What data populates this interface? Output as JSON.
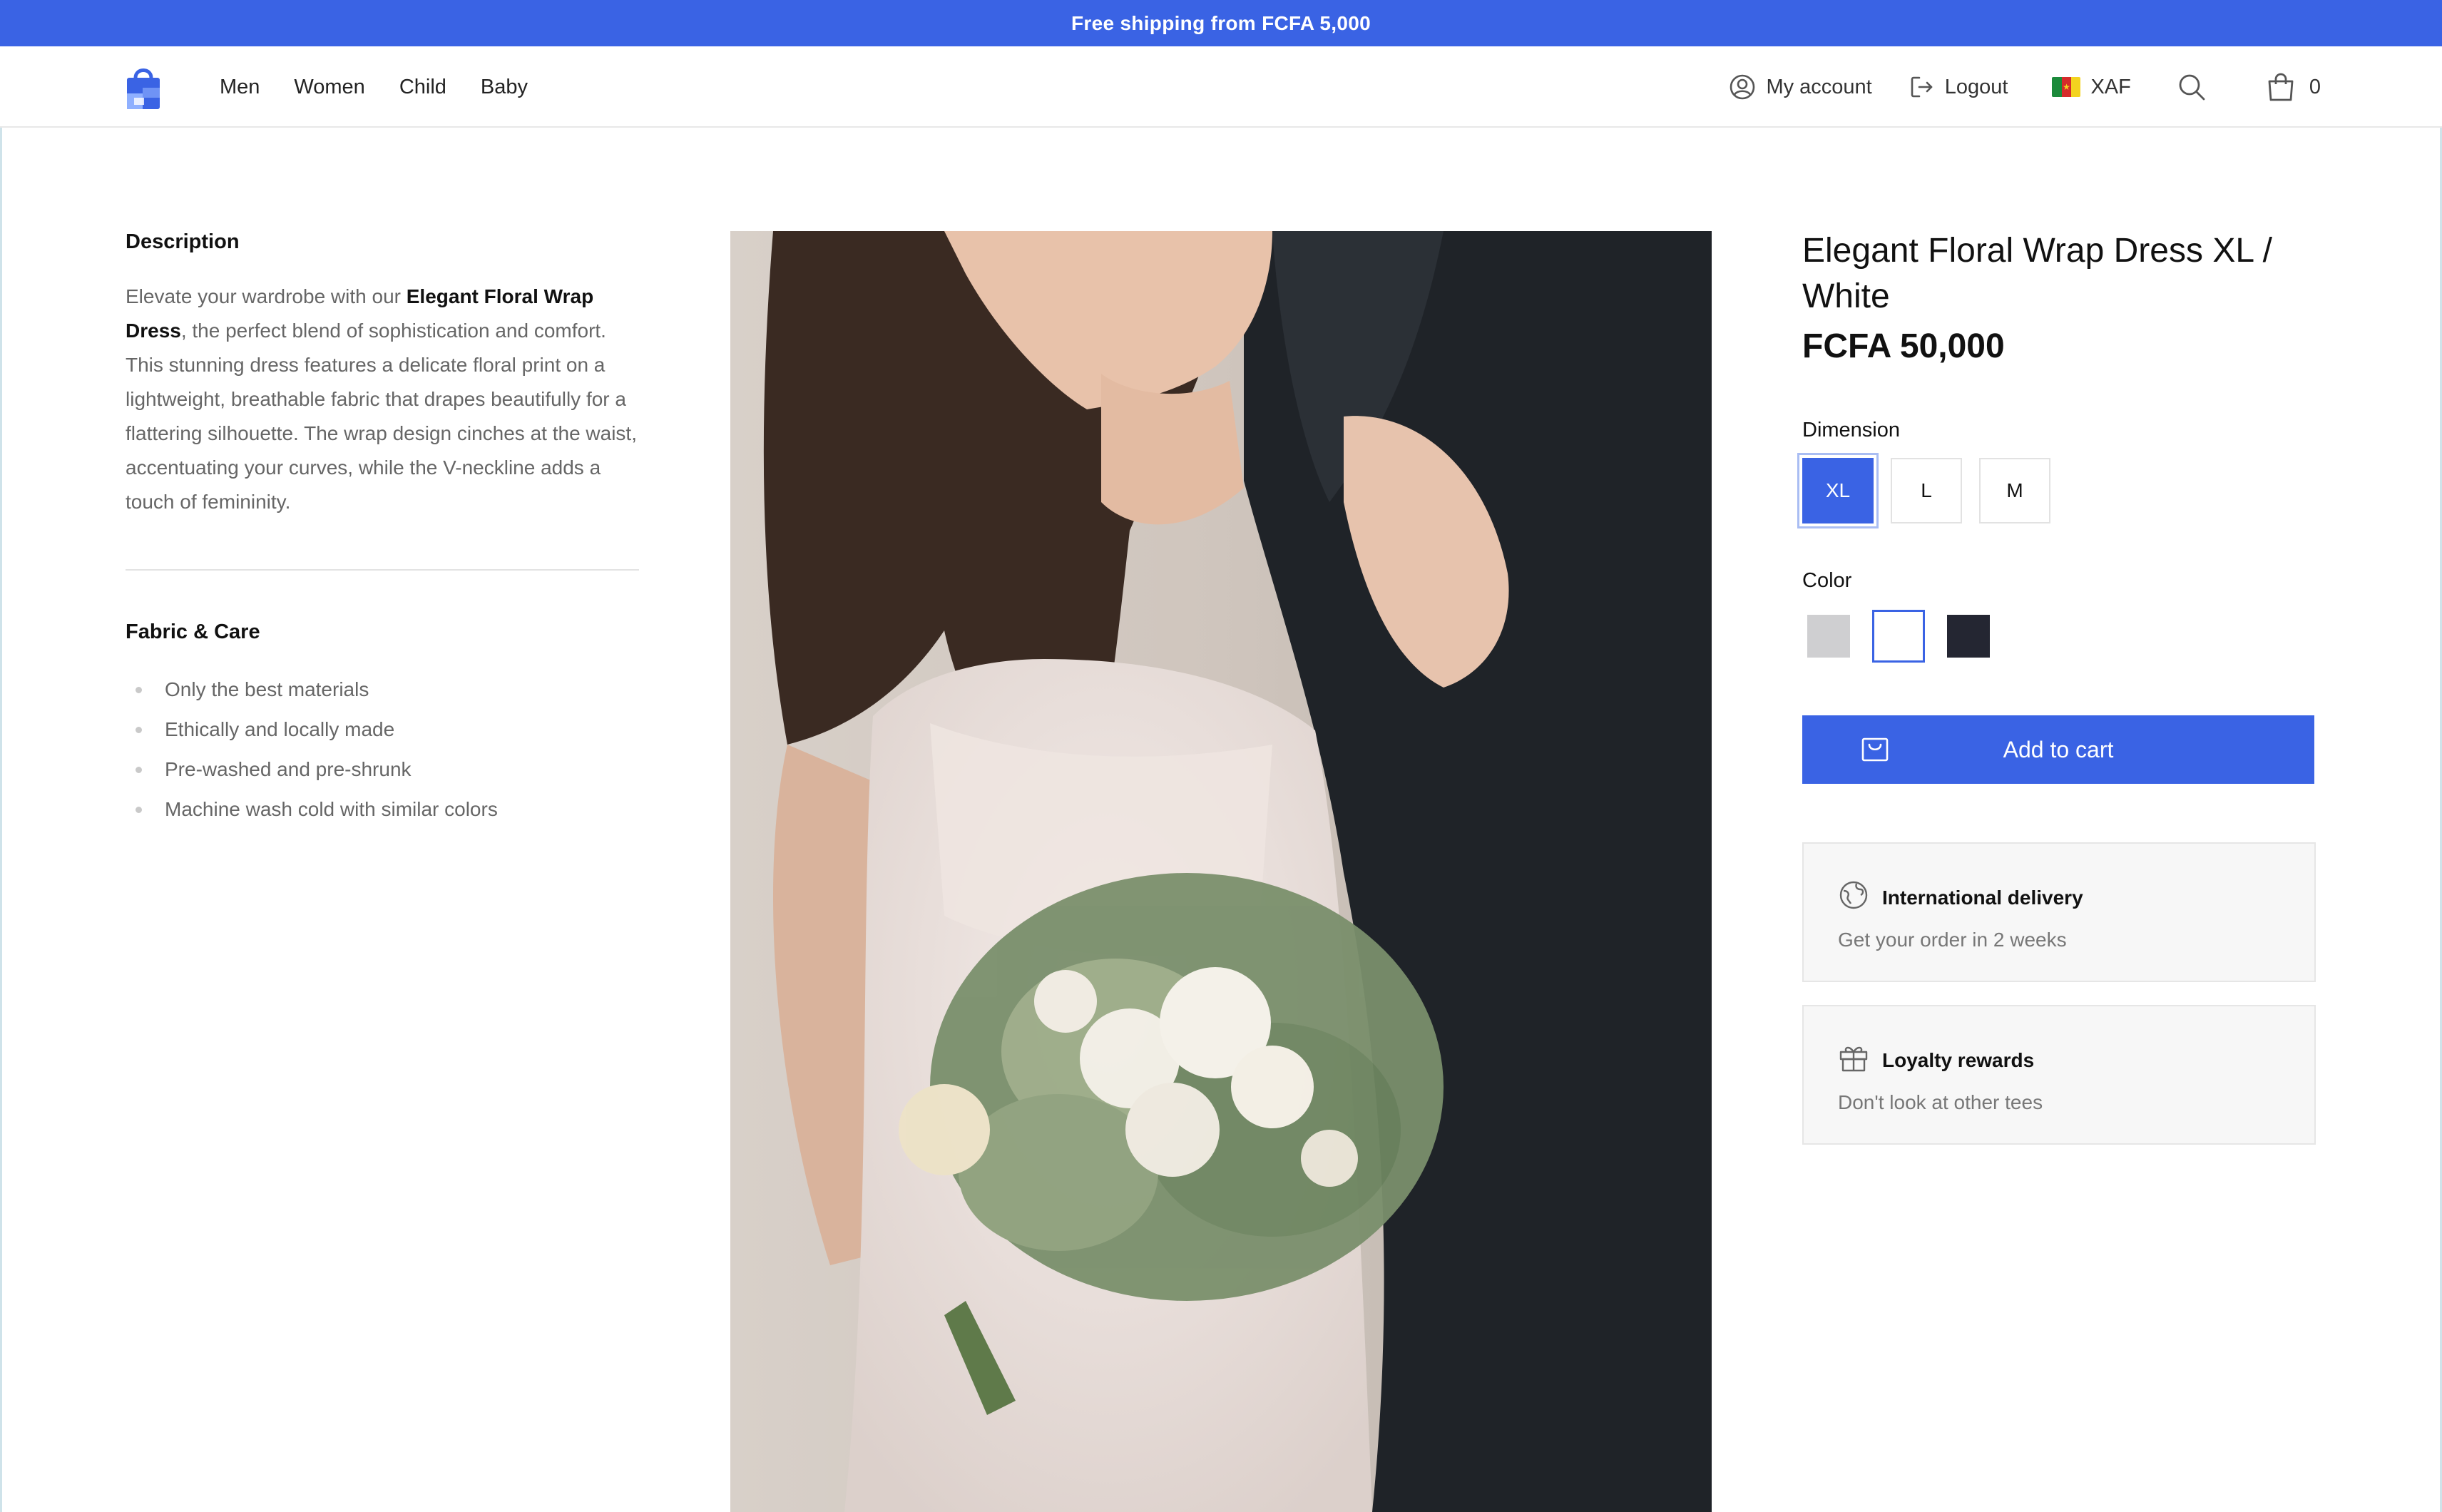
{
  "promo": {
    "text": "Free shipping from FCFA 5,000"
  },
  "header": {
    "nav": [
      "Men",
      "Women",
      "Child",
      "Baby"
    ],
    "account_label": "My account",
    "logout_label": "Logout",
    "currency": "XAF",
    "cart_count": "0",
    "flag_icon": "cameroon-flag-icon",
    "brand_color": "#3a63e4"
  },
  "description": {
    "title": "Description",
    "text_before": "Elevate your wardrobe with our ",
    "text_bold": "Elegant Floral Wrap Dress",
    "text_after": ", the perfect blend of sophistication and comfort. This stunning dress features a delicate floral print on a lightweight, breathable fabric that drapes beautifully for a flattering silhouette. The wrap design cinches at the waist, accentuating your curves, while the V-neckline adds a touch of femininity."
  },
  "fabric": {
    "title": "Fabric & Care",
    "items": [
      "Only the best materials",
      "Ethically and locally made",
      "Pre-washed and pre-shrunk",
      "Machine wash cold with similar colors"
    ]
  },
  "product": {
    "title": "Elegant Floral Wrap Dress XL / White",
    "price": "FCFA 50,000",
    "dimension_label": "Dimension",
    "sizes": [
      "XL",
      "L",
      "M"
    ],
    "selected_size": "XL",
    "color_label": "Color",
    "colors": [
      {
        "name": "Grey",
        "hex": "#cfcfd1"
      },
      {
        "name": "White",
        "hex": "#ffffff"
      },
      {
        "name": "Black",
        "hex": "#242632"
      }
    ],
    "selected_color": "White",
    "add_to_cart": "Add to cart"
  },
  "perks": [
    {
      "icon": "globe-icon",
      "title": "International delivery",
      "subtitle": "Get your order in 2 weeks"
    },
    {
      "icon": "gift-icon",
      "title": "Loyalty rewards",
      "subtitle": "Don't look at other tees"
    }
  ]
}
